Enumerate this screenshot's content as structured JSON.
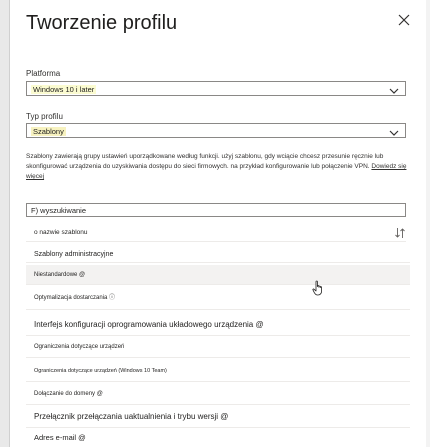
{
  "panel": {
    "title": "Tworzenie profilu",
    "platform_label": "Platforma",
    "platform_value": "Windows 10 i later",
    "profile_type_label": "Typ profilu",
    "profile_type_value": "Szablony",
    "description": "Szablony zawierają grupy ustawień uporządkowane według funkcji. użyj szablonu, gdy wciącie chcesz przesunie ręcznie lub skonfigurować urządzenia do uzyskiwania dostępu do sieci firmowych. na przykład konfigurowanie lub połączenie VPN.",
    "learn_more": "Dowiedz się więcej",
    "search_value": "F) wyszukiwanie",
    "column_header": "o nazwie szablonu",
    "icons": {
      "close": "close-icon",
      "chevron": "chevron-down-icon",
      "sort": "sort-icon",
      "cursor": "hand-pointer-icon"
    }
  },
  "templates": [
    {
      "label": "Szablony administracyjne"
    },
    {
      "label": "Niestandardowe @"
    },
    {
      "label": "Optymalizacja dostarczania ⓘ"
    },
    {
      "label": "Interfejs konfiguracji oprogramowania układowego urządzenia @"
    },
    {
      "label": "Ograniczenia dotyczące urządzeń"
    },
    {
      "label": "Ograniczenia dotyczące urządzeń (Windows 10 Team)"
    },
    {
      "label": "Dołączanie do domeny @"
    },
    {
      "label": "Przełącznik przełączania uaktualnienia i trybu wersji @"
    },
    {
      "label": "Adres e-mail @"
    }
  ]
}
